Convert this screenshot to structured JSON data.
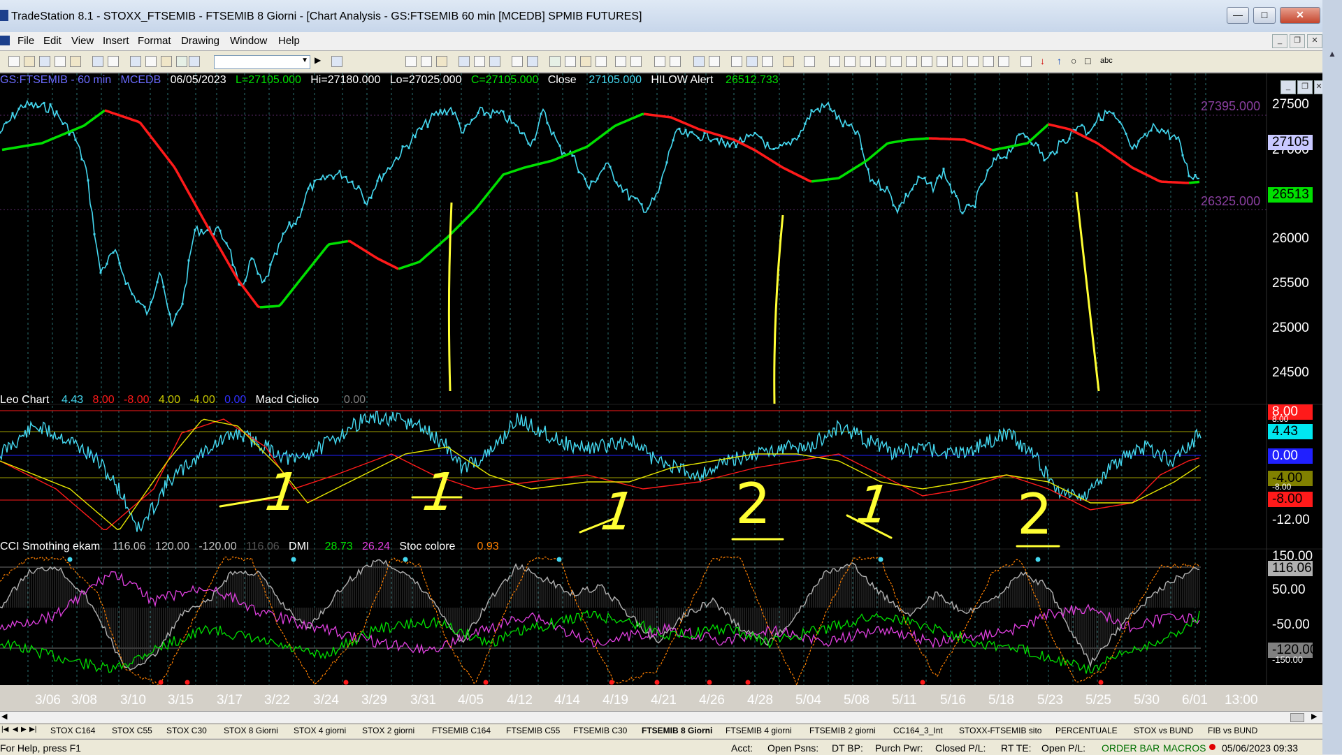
{
  "window": {
    "title": "TradeStation 8.1 - STOXX_FTSEMIB - FTSEMIB  8 Giorni - [Chart Analysis - GS:FTSEMIB  60 min  [MCEDB] SPMIB FUTURES]"
  },
  "menu": [
    "File",
    "Edit",
    "View",
    "Insert",
    "Format",
    "Drawing",
    "Window",
    "Help"
  ],
  "price_header": {
    "symbol": "GS:FTSEMIB - 60 min",
    "data": "MCEDB",
    "date": "06/05/2023",
    "l": "L=27105.000",
    "hi": "Hi=27180.000",
    "lo": "Lo=27025.000",
    "c": "C=27105.000",
    "close_label": "Close",
    "close_val": "27105.000",
    "hilow_label": "HILOW Alert",
    "hilow_val": "26512.733"
  },
  "leo_header": {
    "name": "Leo Chart",
    "v1": "4.43",
    "v2": "8.00",
    "v3": "-8.00",
    "v4": "4.00",
    "v5": "-4.00",
    "v6": "0.00",
    "macd": "Macd Ciclico",
    "macd_v": "0.00"
  },
  "cci_header": {
    "name": "CCI Smothing ekam",
    "v1": "116.06",
    "v2": "120.00",
    "v3": "-120.00",
    "v4": "116.06",
    "dmi": "DMI",
    "dmi_p": "28.73",
    "dmi_m": "26.24",
    "stoc": "Stoc colore",
    "stoc_v": "0.93"
  },
  "price_axis": [
    "27500",
    "27000",
    "26500",
    "26000",
    "25500",
    "25000",
    "24500"
  ],
  "price_levels": {
    "upper": "27395.000",
    "lower": "26325.000"
  },
  "price_badges": {
    "last": "27105",
    "hilow": "26513"
  },
  "leo_axis": {
    "badges": [
      "8.00",
      "4.43",
      "0.00",
      "-4.00",
      "-8.00"
    ],
    "ghost": [
      "8.00",
      "-8.00"
    ],
    "bottom": "-12.00"
  },
  "cci_axis": {
    "top": "150.00",
    "badge_top": "116.06",
    "p50": "50.00",
    "m50": "-50.00",
    "badge_bot": "-120.00",
    "ghost_bot": "-150.00"
  },
  "dates": [
    "3/06",
    "3/08",
    "3/10",
    "3/15",
    "3/17",
    "3/22",
    "3/24",
    "3/29",
    "3/31",
    "4/05",
    "4/12",
    "4/14",
    "4/19",
    "4/21",
    "4/26",
    "4/28",
    "5/04",
    "5/08",
    "5/11",
    "5/16",
    "5/18",
    "5/23",
    "5/25",
    "5/30",
    "6/01",
    "13:00"
  ],
  "annotations": [
    "1",
    "1",
    "1",
    "2",
    "1",
    "2"
  ],
  "tabs": [
    "STOX C164",
    "STOX C55",
    "STOX  C30",
    "STOX  8 Giorni",
    "STOX 4 giorni",
    "STOX  2 giorni",
    "FTSEMIB C164",
    "FTSEMIB C55",
    "FTSEMIB C30",
    "FTSEMIB  8 Giorni",
    "FTSEMIB  4 giorni",
    "FTSEMIB  2 giorni",
    "CC164_3_Int",
    "STOXX-FTSEMIB sito",
    "PERCENTUALE",
    "STOX vs BUND",
    "FIB vs BUND"
  ],
  "status": {
    "help": "For Help, press F1",
    "acct": "Acct:",
    "open_psns": "Open Psns:",
    "dt_bp": "DT BP:",
    "purch": "Purch Pwr:",
    "closed": "Closed P/L:",
    "rt": "RT TE:",
    "open_pl": "Open P/L:",
    "order": "ORDER BAR",
    "macros": "MACROS",
    "datetime": "05/06/2023 09:33"
  },
  "colors": {
    "cyan": "#44d8f0",
    "green": "#00e000",
    "red": "#ff1a1a",
    "yellow": "#ffff33",
    "magenta": "#e040e0",
    "orange": "#ff8000",
    "gray": "#b0b0b0",
    "blue": "#2020ff"
  }
}
